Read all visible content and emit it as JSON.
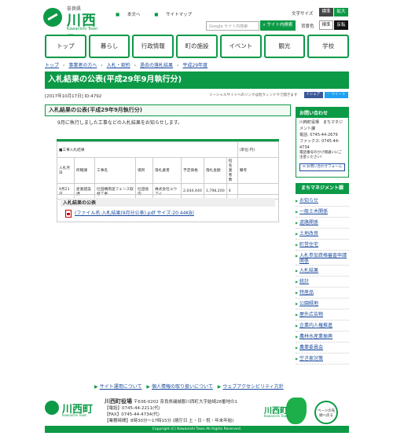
{
  "header": {
    "prefecture": "奈良県",
    "town_name": "川西町",
    "town_roman": "Kawanishi Town",
    "link_home": "本文へ",
    "link_sitemap": "サイトマップ",
    "search_placeholder": "Google サイト内検索",
    "search_button": "サイト内検索",
    "font_size_label": "文字サイズ",
    "font_size_standard": "標準",
    "font_size_large": "拡大",
    "bg_color_label": "背景色",
    "bg_standard": "標準",
    "bg_inverted": "反転"
  },
  "nav": [
    "トップ",
    "暮らし",
    "行政情報",
    "町の施設",
    "イベント",
    "観光",
    "学校"
  ],
  "breadcrumb": [
    "トップ",
    "事業者の方へ",
    "入札・契約",
    "過去の落札結果",
    "平成29年度"
  ],
  "page": {
    "title": "入札結果の公表(平成29年9月執行分)",
    "date_id": "[2017年10月17日]  ID:4792",
    "window_note": "ソーシャルサイトへのリンクは別ウィンドウで開きます",
    "share_facebook": "シェア",
    "share_twitter": "ツイート",
    "section_heading": "入札結果の公表(平成29年9月執行分)",
    "lead": "9月に執行しました工事などの入札結果をお知らせします。"
  },
  "table": {
    "caption": "■工事入札結果",
    "unit": "(単位:円)",
    "headers": [
      "入札月日",
      "所轄課",
      "工事名",
      "場所",
      "落札業者",
      "予定価格",
      "落札金額",
      "指名業者数",
      "備考"
    ],
    "rows": [
      [
        "9月21日",
        "産業建設課",
        "吐田構南話フェンス取替工事",
        "吐田他内",
        "株式会社ユウアイ",
        "2,044,440",
        "1,798,200",
        "4",
        ""
      ]
    ]
  },
  "attachment": {
    "heading": "入札結果の公表",
    "file_label": "(ファイル名:入札結果(9月分公表).pdf サイズ:20.44KB)"
  },
  "contact": {
    "heading": "お問い合わせ",
    "department": "川西町役場　まちマネジメント課",
    "phone": "電話: 0745-44-2679",
    "fax": "ファックス: 0745-44-4734",
    "note": "電話番号のかけ間違いにご注意ください!",
    "form_button": "お問い合わせフォーム"
  },
  "side": {
    "heading": "まちマネジメント課",
    "items": [
      "お知らせ",
      "一般土木関係",
      "道路関係",
      "土地改良",
      "町営住宅",
      "入札参加資格審査申請関係",
      "入札結果",
      "統計",
      "特産品",
      "公園緑地",
      "屋外広告物",
      "企業内人権推進",
      "農林水産業振興",
      "農業委員会",
      "空き家対策"
    ]
  },
  "footer": {
    "links": [
      "サイト運用について",
      "個人情報の取り扱いについて",
      "ウェブアクセシビリティ方針"
    ],
    "office": "川西町役場",
    "address": "〒636-0202 奈良県磯城郡川西町大字結崎28番地の1",
    "tel": "【電話】0745-44-2211(代)",
    "fax": "【FAX】0745-44-4734(代)",
    "hours": "【業務時間】8時30分〜17時15分 (閉庁日 土・日・祝・年末年始)",
    "to_top": "ページの先頭へ戻る",
    "copyright": "Copyright (C) Kawanishi Town All Rights Reserved."
  }
}
